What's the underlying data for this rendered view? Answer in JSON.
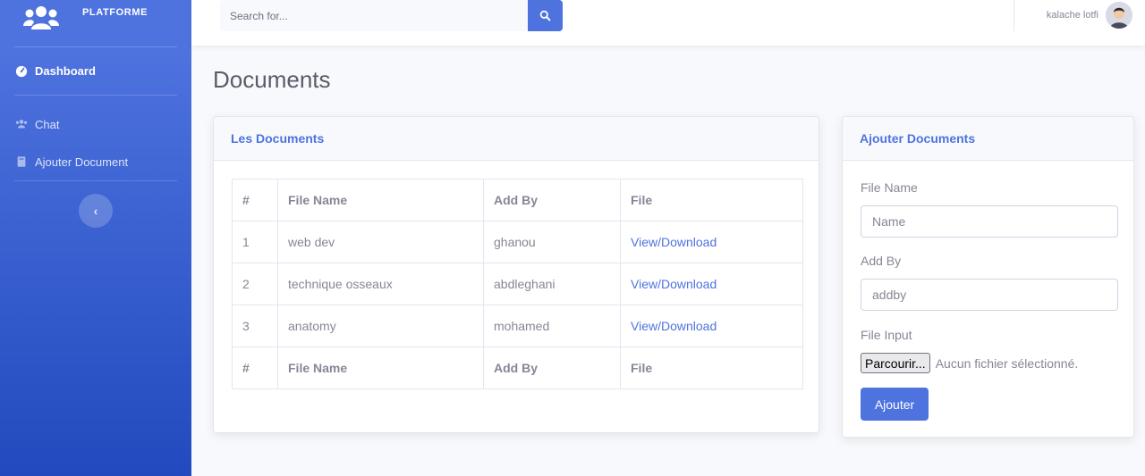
{
  "brand": {
    "title": "PLATFORME",
    "icon": "users-icon"
  },
  "sidebar": {
    "items": [
      {
        "label": "Dashboard",
        "icon": "tachometer-icon",
        "active": true
      },
      {
        "label": "Chat",
        "icon": "users-icon",
        "active": false
      },
      {
        "label": "Ajouter Document",
        "icon": "book-icon",
        "active": false
      }
    ],
    "toggle_icon": "chevron-left-icon",
    "toggle_glyph": "‹"
  },
  "topbar": {
    "search_placeholder": "Search for...",
    "search_icon": "search-icon",
    "user_name": "kalache lotfi",
    "avatar_icon": "user-avatar"
  },
  "page": {
    "title": "Documents"
  },
  "documents_card": {
    "title": "Les Documents",
    "columns": [
      "#",
      "File Name",
      "Add By",
      "File"
    ],
    "rows": [
      {
        "num": "1",
        "file_name": "web dev",
        "add_by": "ghanou",
        "file": "View/Download"
      },
      {
        "num": "2",
        "file_name": "technique osseaux",
        "add_by": "abdleghani",
        "file": "View/Download"
      },
      {
        "num": "3",
        "file_name": "anatomy",
        "add_by": "mohamed",
        "file": "View/Download"
      }
    ],
    "footer": [
      "#",
      "File Name",
      "Add By",
      "File"
    ]
  },
  "add_card": {
    "title": "Ajouter Documents",
    "file_name_label": "File Name",
    "file_name_placeholder": "Name",
    "add_by_label": "Add By",
    "add_by_placeholder": "addby",
    "file_input_label": "File Input",
    "browse_label": "Parcourir...",
    "file_status": "Aucun fichier sélectionné.",
    "submit_label": "Ajouter"
  },
  "colors": {
    "primary": "#4e73df",
    "sidebar_gradient_end": "#224abe",
    "text": "#858796",
    "background": "#f8f9fc"
  }
}
